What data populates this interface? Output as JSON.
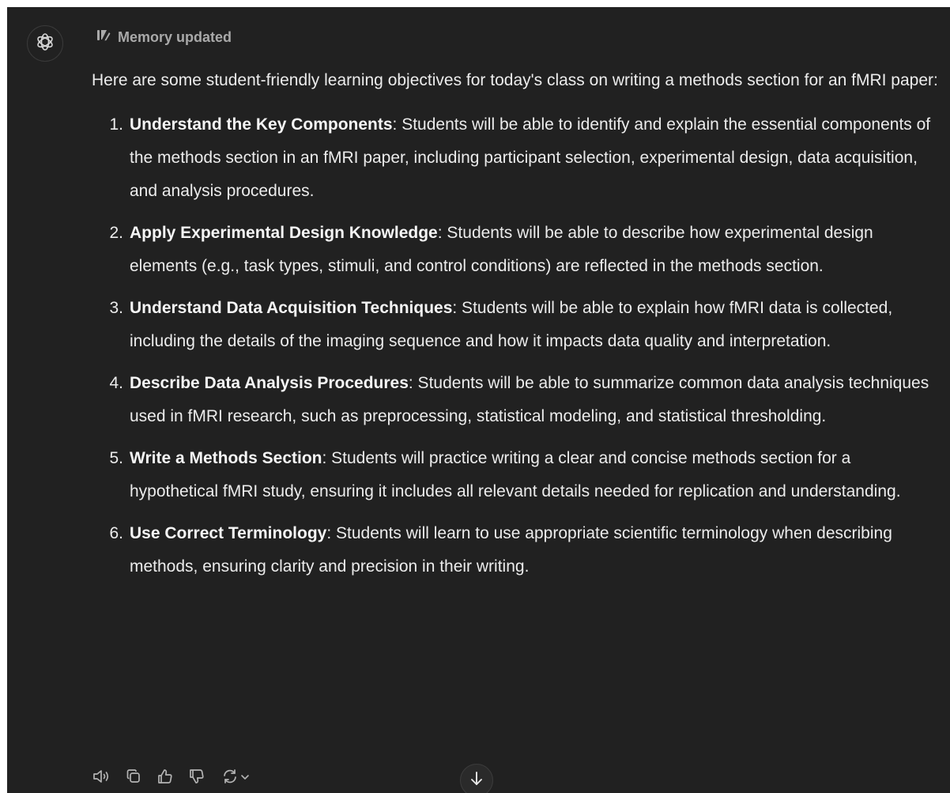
{
  "message": {
    "memory_status": "Memory updated",
    "intro": "Here are some student-friendly learning objectives for today's class on writing a methods section for an fMRI paper:",
    "objectives": [
      {
        "number": "1.",
        "title": "Understand the Key Components",
        "text": ": Students will be able to identify and explain the essential components of the methods section in an fMRI paper, including participant selection, experimental design, data acquisition, and analysis procedures."
      },
      {
        "number": "2.",
        "title": "Apply Experimental Design Knowledge",
        "text": ": Students will be able to describe how experimental design elements (e.g., task types, stimuli, and control conditions) are reflected in the methods section."
      },
      {
        "number": "3.",
        "title": "Understand Data Acquisition Techniques",
        "text": ": Students will be able to explain how fMRI data is collected, including the details of the imaging sequence and how it impacts data quality and interpretation."
      },
      {
        "number": "4.",
        "title": "Describe Data Analysis Procedures",
        "text": ": Students will be able to summarize common data analysis techniques used in fMRI research, such as preprocessing, statistical modeling, and statistical thresholding."
      },
      {
        "number": "5.",
        "title": "Write a Methods Section",
        "text": ": Students will practice writing a clear and concise methods section for a hypothetical fMRI study, ensuring it includes all relevant details needed for replication and understanding."
      },
      {
        "number": "6.",
        "title": "Use Correct Terminology",
        "text": ": Students will learn to use appropriate scientific terminology when describing methods, ensuring clarity and precision in their writing."
      }
    ]
  },
  "icons": {
    "avatar": "openai-logo-icon",
    "memory": "memory-edit-icon",
    "actions": [
      "read-aloud-icon",
      "copy-icon",
      "thumbs-up-icon",
      "thumbs-down-icon",
      "regenerate-icon",
      "chevron-down-icon"
    ],
    "scroll": "arrow-down-icon"
  },
  "colors": {
    "background": "#212121",
    "text": "#ececec",
    "muted": "#a9a9a9"
  }
}
